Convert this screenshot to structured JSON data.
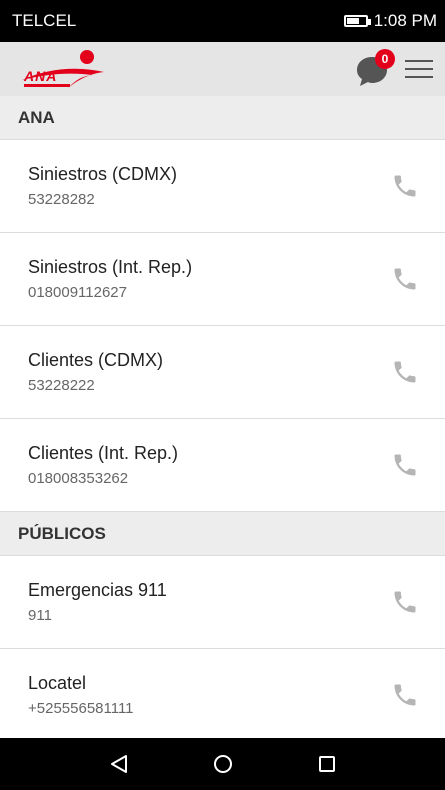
{
  "status_bar": {
    "carrier": "TELCEL",
    "time": "1:08 PM",
    "battery_level": 0.7
  },
  "header": {
    "logo_text": "ANA",
    "notification_count": "0",
    "icons": {
      "chat": "chat-bubble-icon",
      "menu": "hamburger-menu-icon"
    }
  },
  "sections": [
    {
      "title": "ANA",
      "contacts": [
        {
          "name": "Siniestros (CDMX)",
          "number": "53228282"
        },
        {
          "name": "Siniestros (Int. Rep.)",
          "number": "018009112627"
        },
        {
          "name": "Clientes (CDMX)",
          "number": "53228222"
        },
        {
          "name": "Clientes (Int. Rep.)",
          "number": "018008353262"
        }
      ]
    },
    {
      "title": "PÚBLICOS",
      "contacts": [
        {
          "name": "Emergencias 911",
          "number": "911"
        },
        {
          "name": "Locatel",
          "number": "+525556581111"
        }
      ]
    }
  ],
  "colors": {
    "brand_red": "#e3001b",
    "header_bg": "#e5e5e5",
    "section_bg": "#ededed",
    "phone_icon": "#b5b5b5"
  }
}
